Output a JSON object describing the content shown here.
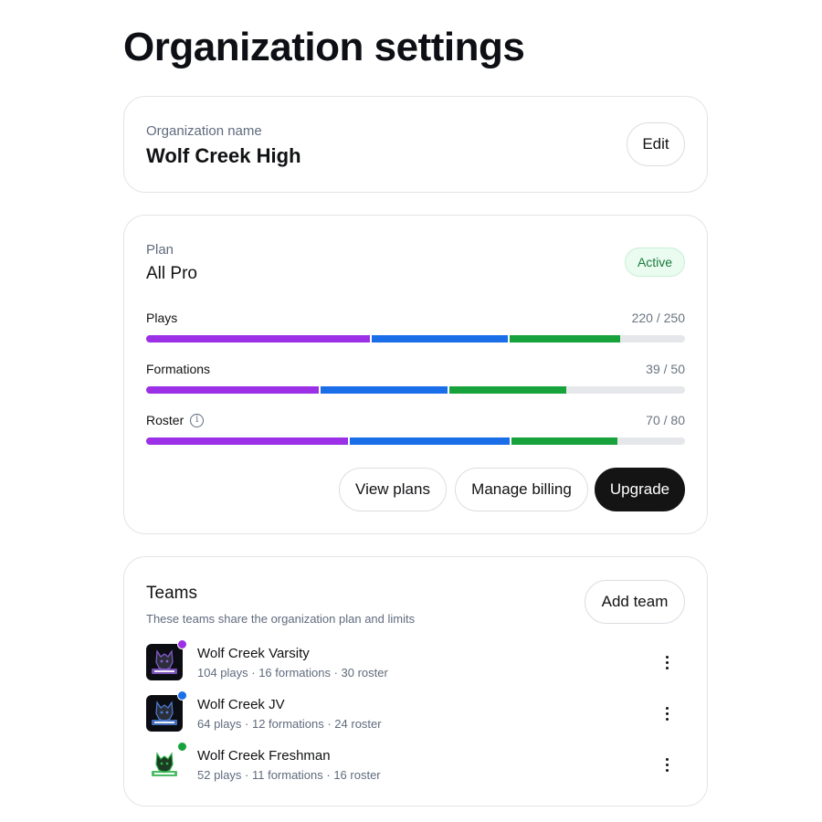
{
  "page": {
    "title": "Organization settings"
  },
  "organization": {
    "label": "Organization name",
    "name": "Wolf Creek High",
    "edit_label": "Edit"
  },
  "plan": {
    "label": "Plan",
    "name": "All Pro",
    "status": "Active",
    "usage": [
      {
        "label": "Plays",
        "count": "220 / 250",
        "used": 220,
        "limit": 250,
        "segments": [
          104,
          64,
          52
        ]
      },
      {
        "label": "Formations",
        "count": "39 / 50",
        "used": 39,
        "limit": 50,
        "segments": [
          16,
          12,
          11
        ]
      },
      {
        "label": "Roster",
        "count": "70 / 80",
        "used": 70,
        "limit": 80,
        "segments": [
          30,
          24,
          16
        ],
        "icon": "info-icon"
      }
    ],
    "actions": {
      "view_plans": "View plans",
      "manage_billing": "Manage billing",
      "upgrade": "Upgrade"
    }
  },
  "teams": {
    "title": "Teams",
    "subtitle": "These teams share the organization plan and limits",
    "add_label": "Add team",
    "list": [
      {
        "name": "Wolf Creek Varsity",
        "stats": "104 plays · 16 formations · 30 roster",
        "color": "#9b30e6",
        "logo_accent": "#8a5cd6"
      },
      {
        "name": "Wolf Creek JV",
        "stats": "64 plays · 12 formations · 24 roster",
        "color": "#1a6fe8",
        "logo_accent": "#4b7fd9"
      },
      {
        "name": "Wolf Creek Freshman",
        "stats": "52 plays · 11 formations · 16 roster",
        "color": "#17a23c",
        "logo_accent": "#2db04a"
      }
    ]
  },
  "colors": {
    "segment_colors": [
      "#9b30e6",
      "#1a6fe8",
      "#17a23c"
    ],
    "track": "#e6e7eb",
    "accent_dark": "#141414"
  }
}
